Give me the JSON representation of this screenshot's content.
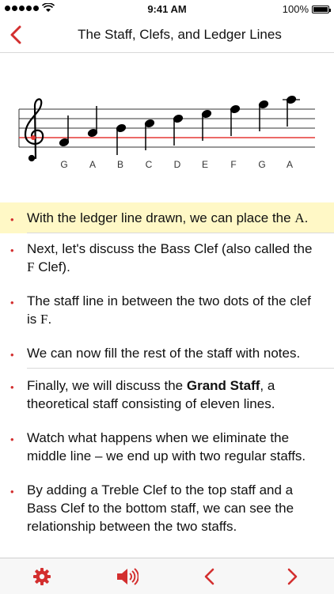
{
  "status_bar": {
    "time": "9:41 AM",
    "battery": "100%",
    "signal_bars_filled": 5
  },
  "nav": {
    "title": "The Staff, Clefs, and Ledger Lines",
    "back_icon": "chevron-left-icon"
  },
  "figure": {
    "note_names": [
      "G",
      "A",
      "B",
      "C",
      "D",
      "E",
      "F",
      "G",
      "A"
    ],
    "clef": "treble-clef"
  },
  "content": {
    "item1": {
      "text": "With the ledger line drawn, we can place the ",
      "note": "A",
      "end": "."
    },
    "item2": {
      "text": "Next, let's discuss the Bass Clef (also called the ",
      "note": "F",
      "end": " Clef)."
    },
    "item3": {
      "text": "The staff line in between the two dots of the clef is ",
      "note": "F",
      "end": "."
    },
    "item4": {
      "text": "We can now fill the rest of the staff with notes."
    },
    "item5": {
      "pre": "Finally, we will discuss the ",
      "bold": "Grand Staff",
      "post": ", a theoretical staff consisting of eleven lines."
    },
    "item6": {
      "text": "Watch what happens when we eliminate the middle line – we end up with two regular staffs."
    },
    "item7": {
      "text": "By adding a Treble Clef to the top staff and a Bass Clef to the bottom staff, we can see the relationship between the two staffs."
    }
  },
  "toolbar": {
    "icons": [
      "gear-icon",
      "speaker-icon",
      "chevron-left-icon",
      "chevron-right-icon"
    ],
    "accent": "#d32f2f"
  },
  "colors": {
    "accent": "#d32f2f",
    "highlight": "#fff8c6"
  }
}
